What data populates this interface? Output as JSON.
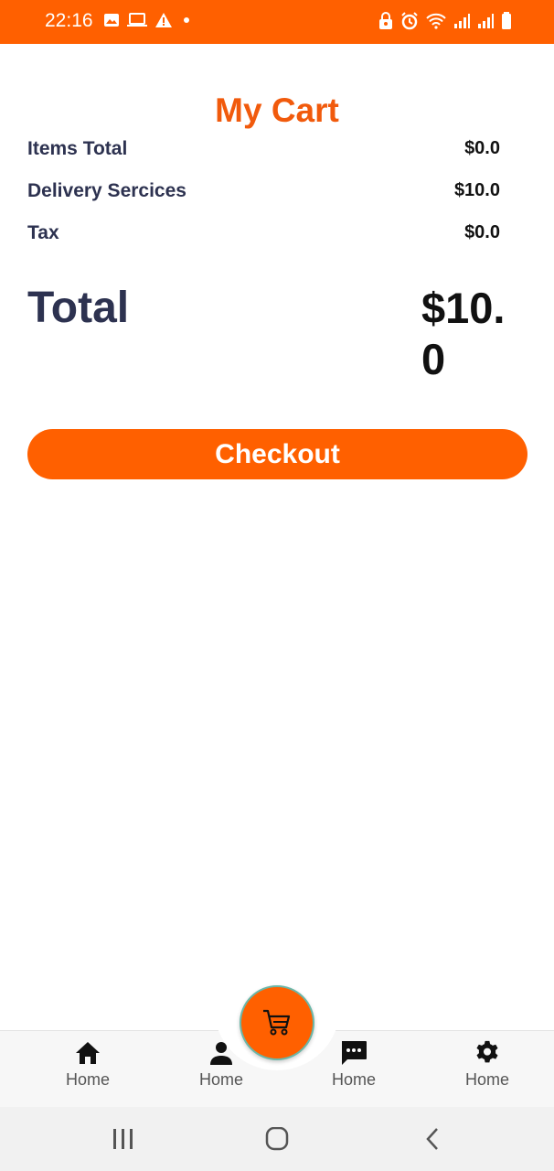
{
  "status_bar": {
    "time": "22:16",
    "color": "#ff6000",
    "left_icons": [
      "image-icon",
      "laptop-icon",
      "warning-icon",
      "dot-icon"
    ],
    "right_icons": [
      "lock-icon",
      "alarm-icon",
      "wifi-icon",
      "signal-icon",
      "signal-icon",
      "battery-icon"
    ]
  },
  "cart": {
    "title": "My Cart",
    "rows": [
      {
        "label": "Items Total",
        "value": "$0.0"
      },
      {
        "label": "Delivery Sercices",
        "value": "$10.0"
      },
      {
        "label": "Tax",
        "value": "$0.0"
      }
    ],
    "total_label": "Total",
    "total_value": "$10.0",
    "checkout_label": "Checkout",
    "accent_color": "#ff6000",
    "title_color": "#f15a0c"
  },
  "bottom_nav": {
    "items": [
      {
        "icon": "home-icon",
        "label": "Home"
      },
      {
        "icon": "person-icon",
        "label": "Home"
      },
      {
        "icon": "chat-icon",
        "label": "Home"
      },
      {
        "icon": "gear-icon",
        "label": "Home"
      }
    ],
    "fab_icon": "cart-icon"
  },
  "system_nav": {
    "buttons": [
      "recent-apps-icon",
      "home-circle-icon",
      "back-icon"
    ]
  }
}
